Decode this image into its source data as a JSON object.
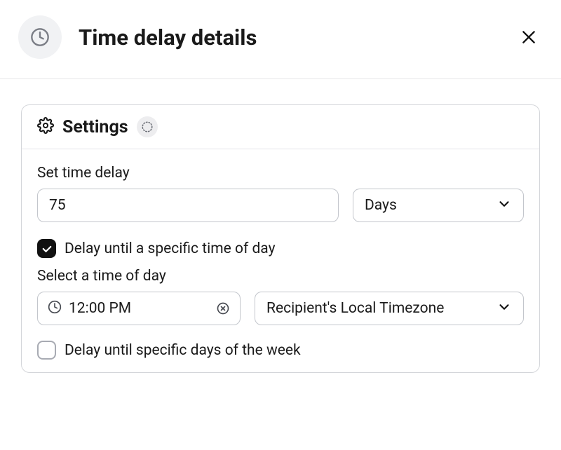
{
  "header": {
    "title": "Time delay details"
  },
  "settings": {
    "panel_title": "Settings",
    "set_delay_label": "Set time delay",
    "delay_value": "75",
    "delay_unit": "Days",
    "specific_time_checkbox_label": "Delay until a specific time of day",
    "select_time_label": "Select a time of day",
    "time_value": "12:00 PM",
    "timezone": "Recipient's Local Timezone",
    "specific_days_checkbox_label": "Delay until specific days of the week"
  }
}
